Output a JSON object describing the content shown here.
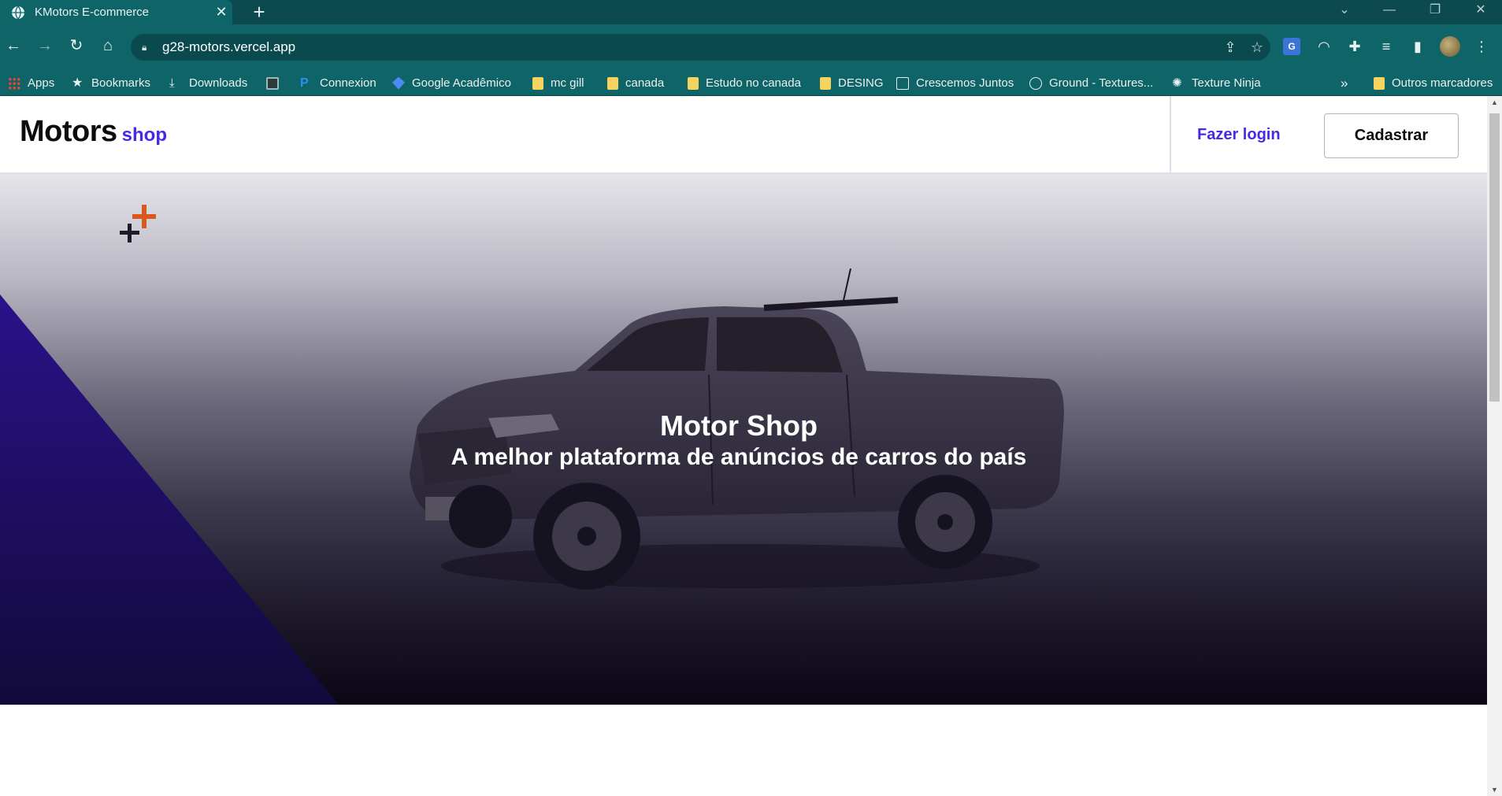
{
  "browser": {
    "tab_title": "KMotors E-commerce",
    "url": "g28-motors.vercel.app",
    "bookmarks": [
      {
        "label": "Apps",
        "icon": "apps-grid-icon"
      },
      {
        "label": "Bookmarks",
        "icon": "star-icon"
      },
      {
        "label": "Downloads",
        "icon": "download-icon"
      },
      {
        "label": "",
        "icon": "extension-icon"
      },
      {
        "label": "Connexion",
        "icon": "paypal-icon"
      },
      {
        "label": "Google Acadêmico",
        "icon": "scholar-icon"
      },
      {
        "label": "mc gill",
        "icon": "folder-icon"
      },
      {
        "label": "canada",
        "icon": "folder-icon"
      },
      {
        "label": "Estudo no canada",
        "icon": "folder-icon"
      },
      {
        "label": "DESING",
        "icon": "folder-icon"
      },
      {
        "label": "Crescemos Juntos",
        "icon": "doc-icon"
      },
      {
        "label": "Ground - Textures...",
        "icon": "texture-icon"
      },
      {
        "label": "Texture Ninja",
        "icon": "ninja-icon"
      }
    ],
    "more_bookmarks": "»",
    "other_bookmarks": "Outros marcadores"
  },
  "site": {
    "logo_main": "Motors",
    "logo_sub": "shop",
    "login": "Fazer login",
    "signup": "Cadastrar",
    "hero_title": "Motor Shop",
    "hero_subtitle": "A melhor plataforma de anúncios de carros do país"
  },
  "colors": {
    "brand": "#4529e6",
    "chrome": "#0f6467",
    "accent_orange": "#d9581e"
  }
}
